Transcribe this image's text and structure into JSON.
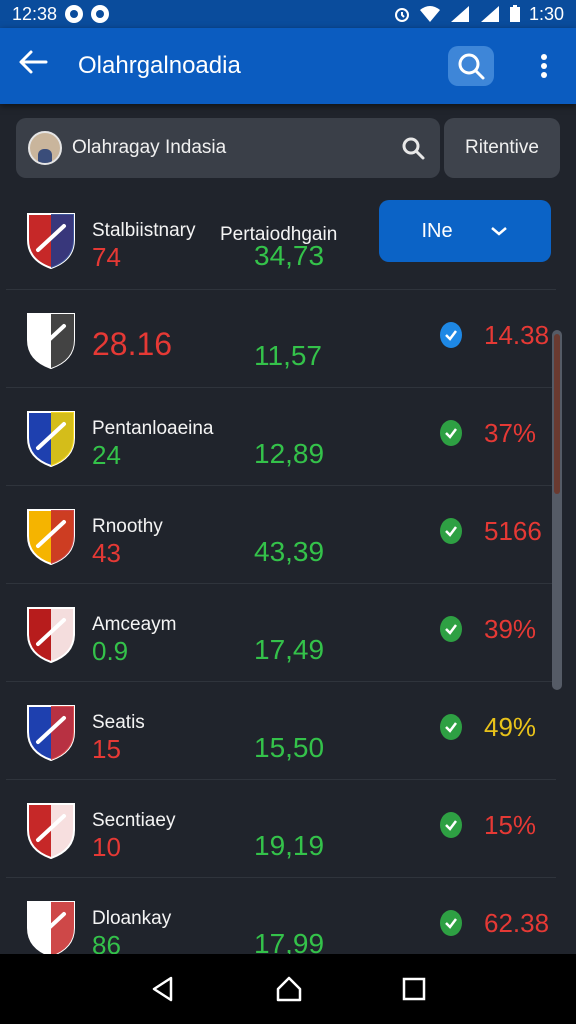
{
  "status_bar": {
    "time_left": "12:38",
    "time_right": "1:30"
  },
  "app_bar": {
    "title": "Olahrgalnoadia"
  },
  "search": {
    "value": "Olahragay Indasia",
    "filter_label": "Ritentive"
  },
  "header": {
    "col_label": "Pertaiodhgain",
    "dropdown_label": "INe"
  },
  "teams": [
    {
      "name": "Stalbiistnary",
      "num": "74",
      "num_color": "#e53935",
      "mid": "34,73",
      "pct": "",
      "pct_color": "#e53935",
      "check": false,
      "crest": [
        "#c62828",
        "#1e3a8a"
      ]
    },
    {
      "name": "",
      "num": "28.16",
      "num_color": "#e53935",
      "mid": "11,57",
      "pct": "14.38",
      "pct_color": "#e53935",
      "check": true,
      "check_color": "#1e88e5",
      "crest": [
        "#ffffff",
        "#222222"
      ]
    },
    {
      "name": "Pentanloaeina",
      "num": "24",
      "num_color": "#34c24a",
      "mid": "12,89",
      "pct": "37%",
      "pct_color": "#e53935",
      "check": true,
      "crest": [
        "#1e40af",
        "#f5d400"
      ]
    },
    {
      "name": "Rnoothy",
      "num": "43",
      "num_color": "#e53935",
      "mid": "43,39",
      "pct": "5166",
      "pct_color": "#e53935",
      "check": true,
      "crest": [
        "#f5b400",
        "#c62828"
      ]
    },
    {
      "name": "Amceaym",
      "num": "0.9",
      "num_color": "#34c24a",
      "mid": "17,49",
      "pct": "39%",
      "pct_color": "#e53935",
      "check": true,
      "crest": [
        "#b71c1c",
        "#ffffff"
      ]
    },
    {
      "name": "Seatis",
      "num": "15",
      "num_color": "#e53935",
      "mid": "15,50",
      "pct": "49%",
      "pct_color": "#e8c21a",
      "check": true,
      "crest": [
        "#1e40af",
        "#d32f2f"
      ]
    },
    {
      "name": "Secntiaey",
      "num": "10",
      "num_color": "#e53935",
      "mid": "19,19",
      "pct": "15%",
      "pct_color": "#e53935",
      "check": true,
      "crest": [
        "#c62828",
        "#ffffff"
      ]
    },
    {
      "name": "Dloankay",
      "num": "86",
      "num_color": "#34c24a",
      "mid": "17,99",
      "pct": "62.38",
      "pct_color": "#e53935",
      "check": true,
      "crest": [
        "#ffffff",
        "#c62828"
      ]
    }
  ],
  "icons": {
    "back": "arrow-left-icon",
    "search": "search-icon",
    "more": "more-vert-icon",
    "check": "check-circle-icon",
    "nav_back": "nav-back-icon",
    "nav_home": "nav-home-icon",
    "nav_recents": "nav-recents-icon"
  }
}
